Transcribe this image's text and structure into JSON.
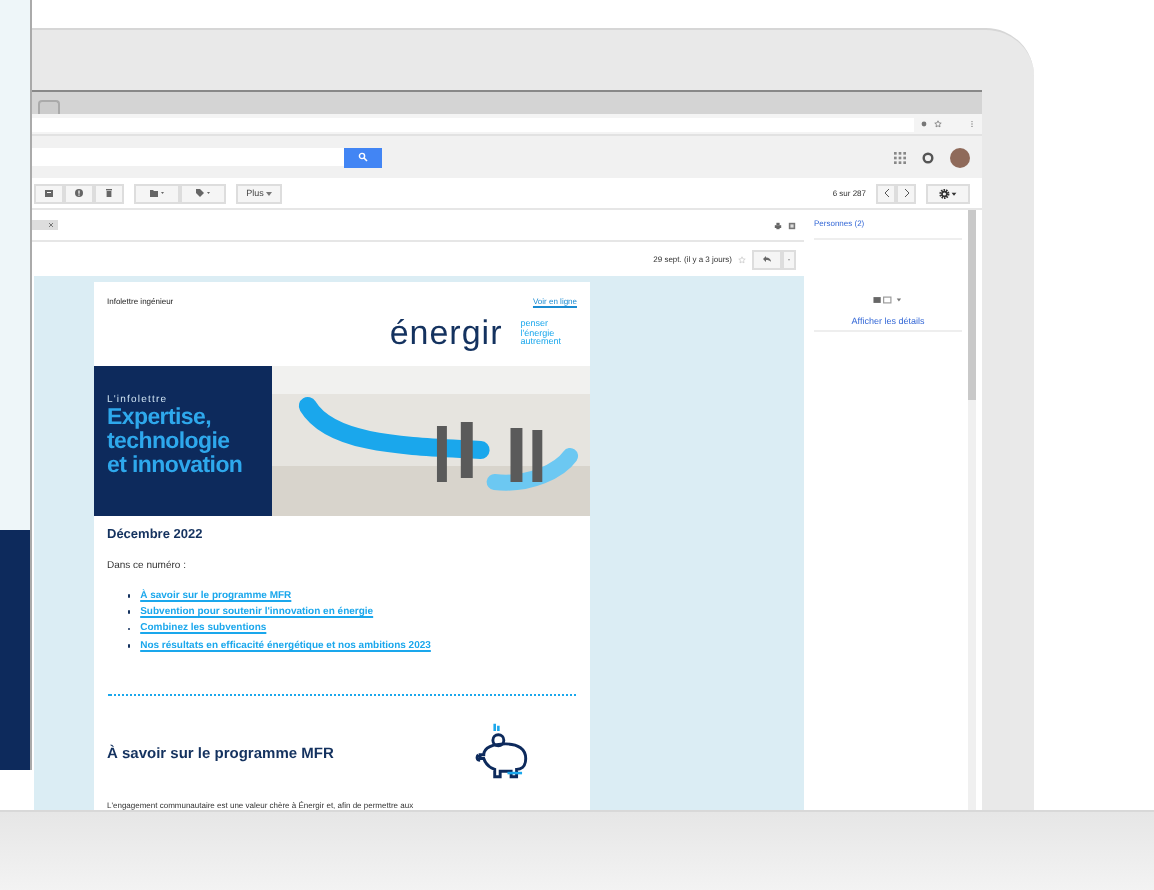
{
  "toolbar": {
    "more_button": "Plus",
    "pagination": "6 sur 287"
  },
  "message": {
    "date": "29 sept. (il y a 3 jours)",
    "starred": false
  },
  "sidebar": {
    "people": "Personnes (2)",
    "details_link": "Afficher les détails"
  },
  "newsletter": {
    "kicker": "Infolettre ingénieur",
    "view_online": "Voir en ligne",
    "logo": "énergir",
    "tagline": [
      "penser",
      "l'énergie",
      "autrement"
    ],
    "hero_kicker": "L'infolettre",
    "hero_title": [
      "Expertise,",
      "technologie",
      "et innovation"
    ],
    "month": "Décembre 2022",
    "intro": "Dans ce numéro :",
    "links": [
      "À savoir sur le programme MFR",
      "Subvention pour soutenir l'innovation en énergie",
      "Combinez les subventions",
      "Nos résultats en efficacité énergétique et nos ambitions 2023"
    ],
    "section_title": "À savoir sur le programme MFR",
    "body": "L'engagement communautaire est une valeur chère à Énergir et, afin de permettre aux"
  }
}
